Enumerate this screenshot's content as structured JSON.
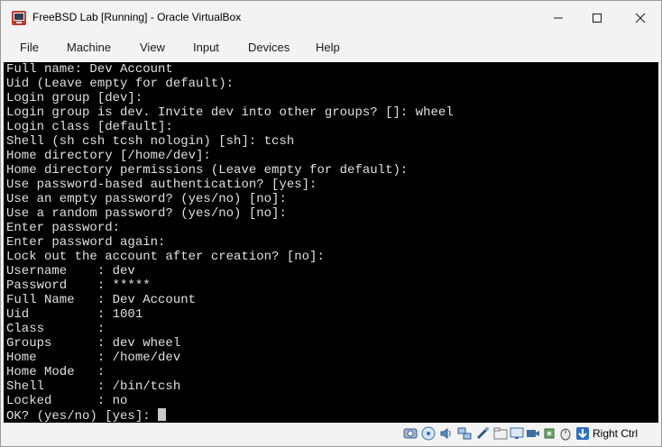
{
  "window": {
    "title": "FreeBSD Lab [Running] - Oracle VirtualBox"
  },
  "menu": [
    "File",
    "Machine",
    "View",
    "Input",
    "Devices",
    "Help"
  ],
  "console_lines": [
    "Full name: Dev Account",
    "Uid (Leave empty for default):",
    "Login group [dev]:",
    "Login group is dev. Invite dev into other groups? []: wheel",
    "Login class [default]:",
    "Shell (sh csh tcsh nologin) [sh]: tcsh",
    "Home directory [/home/dev]:",
    "Home directory permissions (Leave empty for default):",
    "Use password-based authentication? [yes]:",
    "Use an empty password? (yes/no) [no]:",
    "Use a random password? (yes/no) [no]:",
    "Enter password:",
    "Enter password again:",
    "Lock out the account after creation? [no]:",
    "Username    : dev",
    "Password    : *****",
    "Full Name   : Dev Account",
    "Uid         : 1001",
    "Class       :",
    "Groups      : dev wheel",
    "Home        : /home/dev",
    "Home Mode   :",
    "Shell       : /bin/tcsh",
    "Locked      : no",
    "OK? (yes/no) [yes]: "
  ],
  "status_icons": [
    "hard-disk-icon",
    "optical-drive-icon",
    "audio-icon",
    "network-icon",
    "usb-icon",
    "shared-folders-icon",
    "display-icon",
    "video-capture-icon",
    "cpu-icon",
    "mouse-integration-icon",
    "keyboard-capture-icon"
  ],
  "status": {
    "host_key": "Right Ctrl"
  },
  "colors": {
    "console_bg": "#000000",
    "console_fg": "#e0e0e0",
    "chrome_bg": "#f3f3f3"
  }
}
